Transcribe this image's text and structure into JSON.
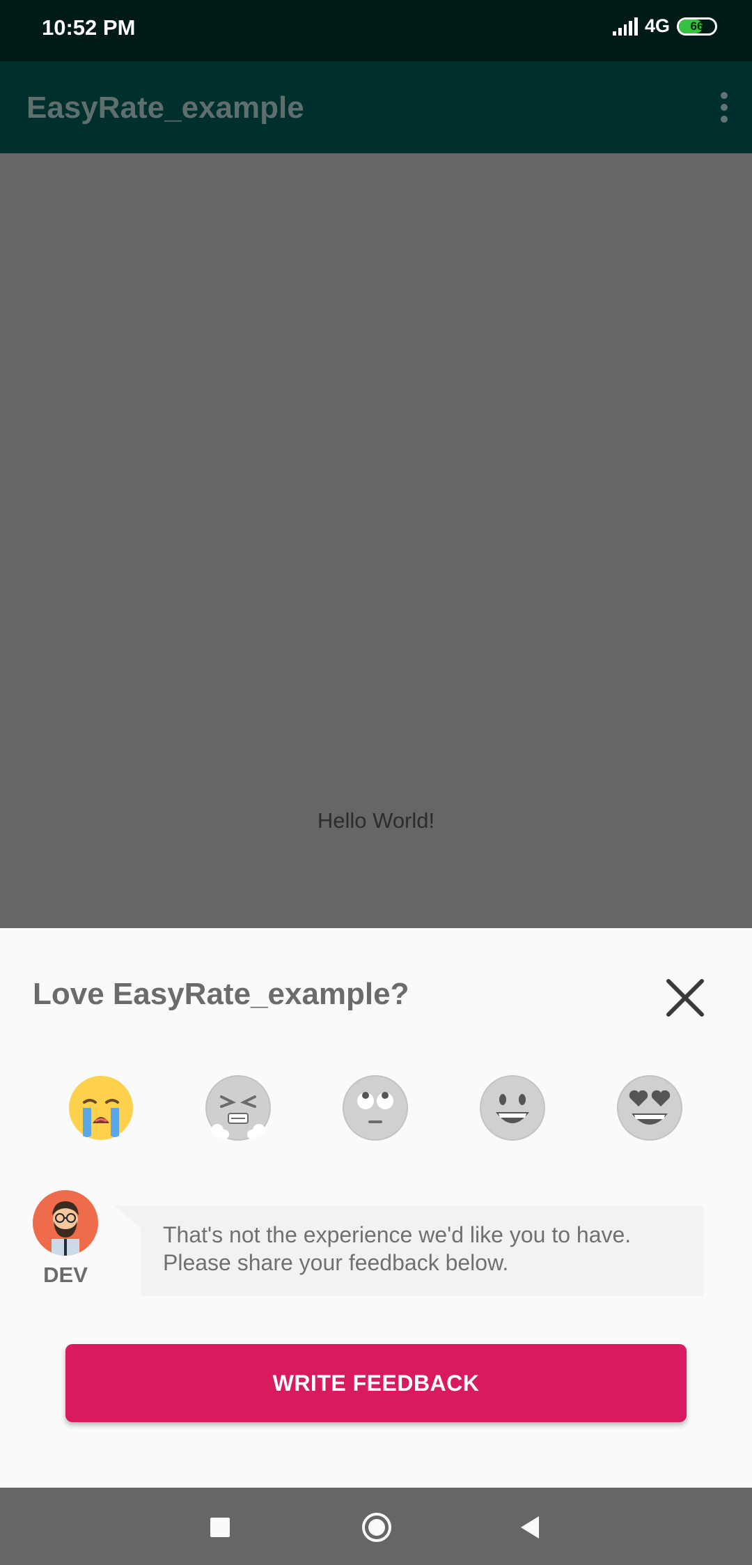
{
  "status_bar": {
    "time": "10:52 PM",
    "network": "4G",
    "battery": "66"
  },
  "app_bar": {
    "title": "EasyRate_example",
    "menu_icon": "overflow-menu-icon"
  },
  "content": {
    "hello_text": "Hello World!"
  },
  "rating_sheet": {
    "title": "Love EasyRate_example?",
    "close_icon": "close-icon",
    "emojis": [
      {
        "name": "crying-emoji",
        "selected": true
      },
      {
        "name": "angry-emoji",
        "selected": false
      },
      {
        "name": "eye-roll-emoji",
        "selected": false
      },
      {
        "name": "smile-emoji",
        "selected": false
      },
      {
        "name": "heart-eyes-emoji",
        "selected": false
      }
    ],
    "dev_label": "DEV",
    "message": "That's not the experience we'd like you to have. Please share your feedback below.",
    "button_label": "WRITE FEEDBACK",
    "accent_color": "#d81b60"
  },
  "nav_bar": {
    "recents_icon": "square-icon",
    "home_icon": "circle-icon",
    "back_icon": "back-triangle-icon"
  }
}
